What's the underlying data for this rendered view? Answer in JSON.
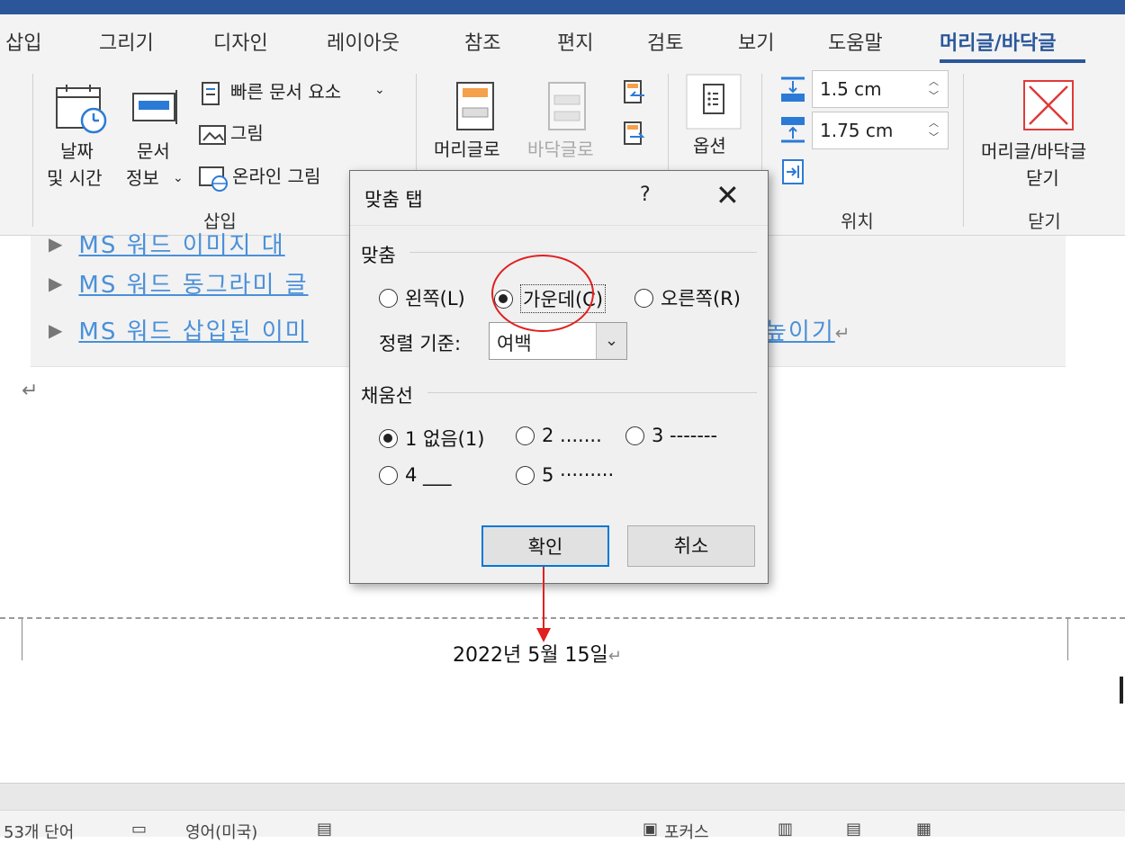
{
  "ribbon": {
    "tabs": [
      {
        "label": "삽입"
      },
      {
        "label": "그리기"
      },
      {
        "label": "디자인"
      },
      {
        "label": "레이아웃"
      },
      {
        "label": "참조"
      },
      {
        "label": "편지"
      },
      {
        "label": "검토"
      },
      {
        "label": "보기"
      },
      {
        "label": "도움말"
      },
      {
        "label": "머리글/바닥글"
      }
    ],
    "insert_group": {
      "date_time": "날짜\n및 시간",
      "date_time_l1": "날짜",
      "date_time_l2": "및 시간",
      "doc_info_l1": "문서",
      "doc_info_l2": "정보",
      "quick_parts": "빠른 문서 요소",
      "picture": "그림",
      "online_picture": "온라인 그림",
      "label": "삽입"
    },
    "nav_group": {
      "goto_header": "머리글로",
      "goto_footer": "바닥글로"
    },
    "options": {
      "label": "옵션"
    },
    "position": {
      "header_value": "1.5 cm",
      "footer_value": "1.75 cm",
      "label": "위치"
    },
    "close": {
      "button": "머리글/바닥글",
      "button_l2": "닫기",
      "label": "닫기"
    }
  },
  "document": {
    "toc": [
      {
        "text": "MS 워드 이미지 대"
      },
      {
        "text": "MS 워드 동그라미 글"
      },
      {
        "text": "MS 워드 삽입된 이미",
        "tail": "높이기"
      }
    ],
    "footer_date": "2022년 5월 15일"
  },
  "dialog": {
    "title": "맞춤 탭",
    "help": "?",
    "alignment_section": "맞춤",
    "align_left": "왼쪽(L)",
    "align_center": "가운데(C)",
    "align_right": "오른쪽(R)",
    "align_relative_label": "정렬 기준:",
    "align_relative_value": "여백",
    "leader_section": "채움선",
    "leader_1": "1 없음(1)",
    "leader_2": "2 .......",
    "leader_3": "3 -------",
    "leader_4": "4 ___",
    "leader_5": "5 ·········",
    "ok": "확인",
    "cancel": "취소"
  },
  "statusbar": {
    "words": "53개 단어",
    "language": "영어(미국)",
    "focus": "포커스"
  },
  "colors": {
    "accent": "#2b579a",
    "annotation": "#e02020",
    "link": "#4a90d9"
  }
}
